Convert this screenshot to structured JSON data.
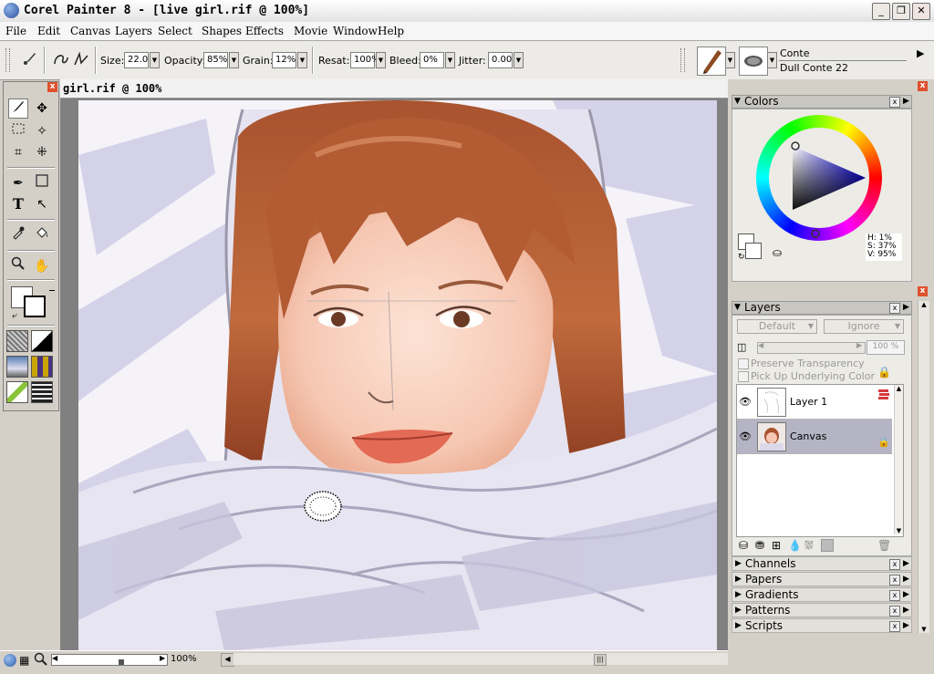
{
  "window": {
    "title": "Corel Painter 8 - [live girl.rif @ 100%]",
    "minimize": "_",
    "restore": "❐",
    "close": "✕"
  },
  "menu": [
    "File",
    "Edit",
    "Canvas",
    "Layers",
    "Select",
    "Shapes",
    "Effects",
    "Movie",
    "Window",
    "Help"
  ],
  "propbar": {
    "size_label": "Size:",
    "size_value": "22.0",
    "opacity_label": "Opacity:",
    "opacity_value": "85%",
    "grain_label": "Grain:",
    "grain_value": "12%",
    "resat_label": "Resat:",
    "resat_value": "100%",
    "bleed_label": "Bleed:",
    "bleed_value": "0%",
    "jitter_label": "Jitter:",
    "jitter_value": "0.00",
    "brush_category": "Conte",
    "brush_variant": "Dull Conte 22"
  },
  "document": {
    "title": "girl.rif @ 100%"
  },
  "status": {
    "zoom": "100%"
  },
  "colors_panel": {
    "title": "Colors",
    "hue": "H: 1%",
    "sat": "S: 37%",
    "val": "V: 95%"
  },
  "layers_panel": {
    "title": "Layers",
    "composite_method": "Default",
    "composite_depth": "Ignore",
    "opacity": "100 %",
    "preserve_transparency": "Preserve Transparency",
    "pick_up_color": "Pick Up Underlying Color",
    "layers": [
      {
        "name": "Layer 1"
      },
      {
        "name": "Canvas"
      }
    ]
  },
  "sub_panels": [
    "Channels",
    "Papers",
    "Gradients",
    "Patterns",
    "Scripts"
  ],
  "colors": {
    "accent_selected_layer": "#b4b4c4",
    "close_red": "#e0502e",
    "paper_bg": "#f4f2f8"
  }
}
